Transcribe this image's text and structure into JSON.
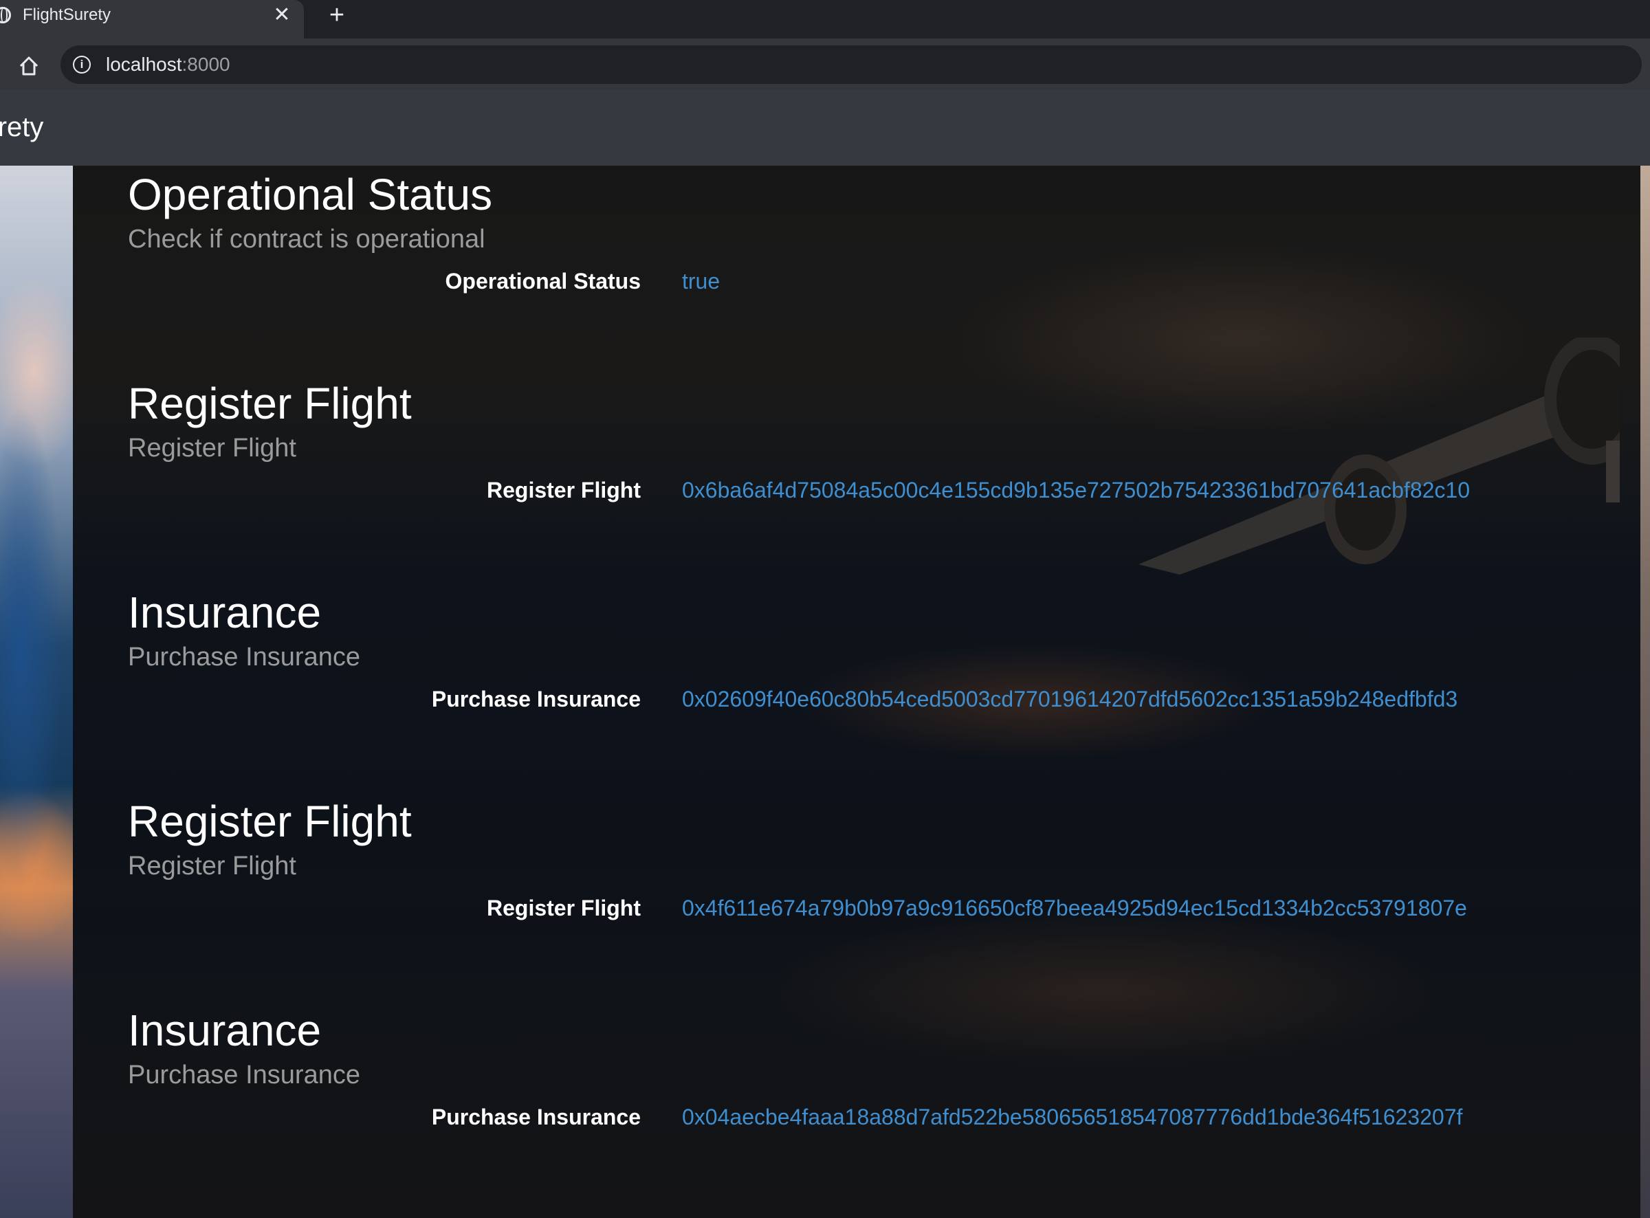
{
  "browser": {
    "tab_title": "FlightSurety",
    "tab_close": "✕",
    "new_tab": "+",
    "url_host": "localhost",
    "url_port": ":8000",
    "info_glyph": "i",
    "star_glyph": "☆",
    "icons": [
      "globe-icon",
      "close-icon",
      "plus-icon",
      "home-icon",
      "info-icon",
      "star-icon"
    ]
  },
  "navbar": {
    "brand": "FlightSurety"
  },
  "sections": [
    {
      "title": "Operational Status",
      "subtitle": "Check if contract is operational",
      "label": "Operational Status",
      "value": "true"
    },
    {
      "title": "Register Flight",
      "subtitle": "Register Flight",
      "label": "Register Flight",
      "value": "0x6ba6af4d75084a5c00c4e155cd9b135e727502b75423361bd707641acbf82c10"
    },
    {
      "title": "Insurance",
      "subtitle": "Purchase Insurance",
      "label": "Purchase Insurance",
      "value": "0x02609f40e60c80b54ced5003cd77019614207dfd5602cc1351a59b248edfbfd3"
    },
    {
      "title": "Register Flight",
      "subtitle": "Register Flight",
      "label": "Register Flight",
      "value": "0x4f611e674a79b0b97a9c916650cf87beea4925d94ec15cd1334b2cc53791807e"
    },
    {
      "title": "Insurance",
      "subtitle": "Purchase Insurance",
      "label": "Purchase Insurance",
      "value": "0x04aecbe4faaa18a88d7afd522be580656518547087776dd1bde364f51623207f"
    }
  ],
  "colors": {
    "navbar": "#343a40",
    "value_link": "#3f8fd0",
    "subtitle": "#9b9b9b"
  }
}
